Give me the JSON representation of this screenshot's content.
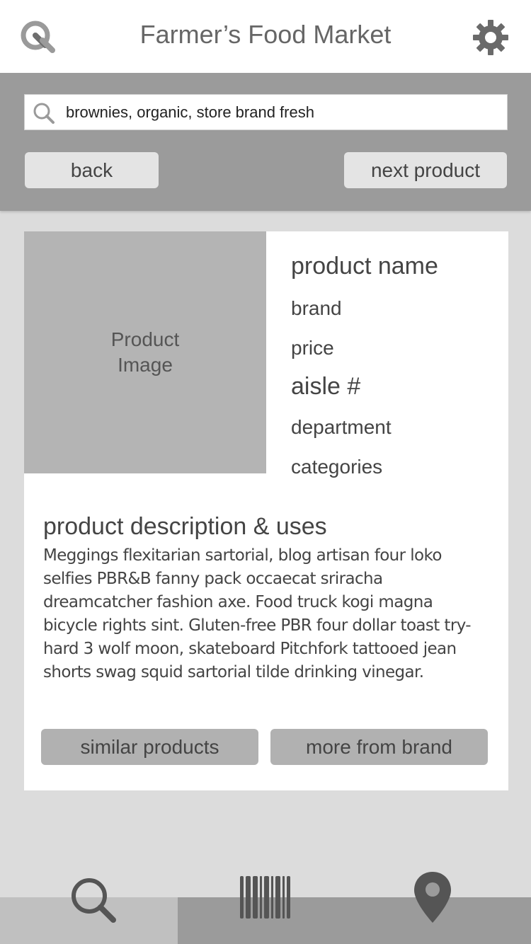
{
  "header": {
    "title": "Farmer’s Food Market",
    "left_icon": "market-search-logo-icon",
    "right_icon": "gear-icon"
  },
  "search": {
    "query": "brownies, organic, store brand fresh",
    "icon": "search-icon"
  },
  "nav": {
    "back_label": "back",
    "next_label": "next product"
  },
  "product": {
    "image_label_line1": "Product",
    "image_label_line2": "Image",
    "name": "product name",
    "brand": "brand",
    "price": "price",
    "aisle": "aisle #",
    "department": "department",
    "categories": "categories"
  },
  "description": {
    "title": "product description & uses",
    "body": "Meggings flexitarian sartorial, blog artisan four loko selfies PBR&B fanny pack occaecat sriracha dreamcatcher fashion axe. Food truck kogi magna bicycle rights sint. Gluten-free PBR four dollar toast try-hard 3 wolf moon, skateboard Pitchfork tattooed jean shorts swag squid sartorial tilde drinking vinegar."
  },
  "actions": {
    "similar_label": "similar products",
    "more_brand_label": "more from brand"
  },
  "tabbar": {
    "tabs": [
      {
        "icon": "search-icon",
        "active": true
      },
      {
        "icon": "barcode-icon",
        "active": false
      },
      {
        "icon": "location-pin-icon",
        "active": false
      }
    ]
  },
  "colors": {
    "page_bg": "#dcdcdc",
    "toolbar_bg": "#9b9b9b",
    "image_placeholder": "#b4b4b4",
    "active_tab_bg": "#c0c0c0"
  }
}
